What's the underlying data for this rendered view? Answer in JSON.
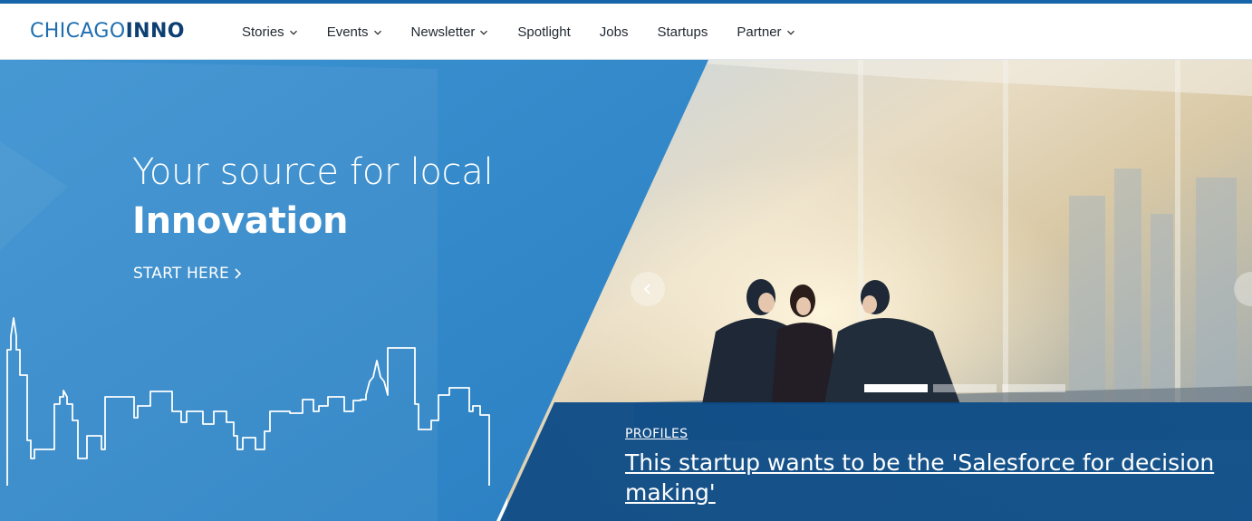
{
  "colors": {
    "brand_blue": "#1f6fb0",
    "brand_dark": "#0d3f73",
    "top_bar": "#1565a8",
    "hero_left": "#2f86c8",
    "story_panel": "#0a4a86"
  },
  "header": {
    "logo_part1": "CHICAGO",
    "logo_part2": "INNO",
    "nav": [
      {
        "label": "Stories",
        "has_dropdown": true
      },
      {
        "label": "Events",
        "has_dropdown": true
      },
      {
        "label": "Newsletter",
        "has_dropdown": true
      },
      {
        "label": "Spotlight",
        "has_dropdown": false
      },
      {
        "label": "Jobs",
        "has_dropdown": false
      },
      {
        "label": "Startups",
        "has_dropdown": false
      },
      {
        "label": "Partner",
        "has_dropdown": true
      }
    ]
  },
  "hero": {
    "headline_line1": "Your source for local",
    "headline_line2": "Innovation",
    "cta_label": "START HERE",
    "icons": [
      "chevron-right-icon",
      "chevron-left-icon",
      "skyline-outline"
    ],
    "carousel": {
      "slide_count": 3,
      "active_index": 0
    },
    "story": {
      "category": "PROFILES",
      "title": "This startup wants to be the 'Salesforce for decision making'"
    }
  }
}
